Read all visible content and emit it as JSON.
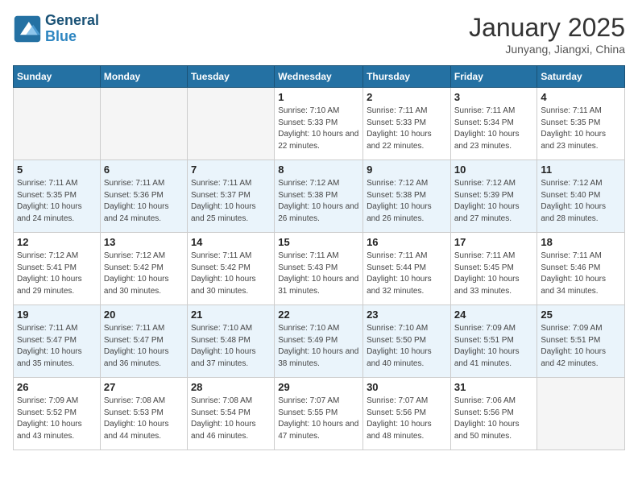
{
  "header": {
    "logo_line1": "General",
    "logo_line2": "Blue",
    "month_title": "January 2025",
    "location": "Junyang, Jiangxi, China"
  },
  "days_header": [
    "Sunday",
    "Monday",
    "Tuesday",
    "Wednesday",
    "Thursday",
    "Friday",
    "Saturday"
  ],
  "weeks": [
    [
      {
        "num": "",
        "sunrise": "",
        "sunset": "",
        "daylight": "",
        "empty": true
      },
      {
        "num": "",
        "sunrise": "",
        "sunset": "",
        "daylight": "",
        "empty": true
      },
      {
        "num": "",
        "sunrise": "",
        "sunset": "",
        "daylight": "",
        "empty": true
      },
      {
        "num": "1",
        "sunrise": "Sunrise: 7:10 AM",
        "sunset": "Sunset: 5:33 PM",
        "daylight": "Daylight: 10 hours and 22 minutes."
      },
      {
        "num": "2",
        "sunrise": "Sunrise: 7:11 AM",
        "sunset": "Sunset: 5:33 PM",
        "daylight": "Daylight: 10 hours and 22 minutes."
      },
      {
        "num": "3",
        "sunrise": "Sunrise: 7:11 AM",
        "sunset": "Sunset: 5:34 PM",
        "daylight": "Daylight: 10 hours and 23 minutes."
      },
      {
        "num": "4",
        "sunrise": "Sunrise: 7:11 AM",
        "sunset": "Sunset: 5:35 PM",
        "daylight": "Daylight: 10 hours and 23 minutes."
      }
    ],
    [
      {
        "num": "5",
        "sunrise": "Sunrise: 7:11 AM",
        "sunset": "Sunset: 5:35 PM",
        "daylight": "Daylight: 10 hours and 24 minutes."
      },
      {
        "num": "6",
        "sunrise": "Sunrise: 7:11 AM",
        "sunset": "Sunset: 5:36 PM",
        "daylight": "Daylight: 10 hours and 24 minutes."
      },
      {
        "num": "7",
        "sunrise": "Sunrise: 7:11 AM",
        "sunset": "Sunset: 5:37 PM",
        "daylight": "Daylight: 10 hours and 25 minutes."
      },
      {
        "num": "8",
        "sunrise": "Sunrise: 7:12 AM",
        "sunset": "Sunset: 5:38 PM",
        "daylight": "Daylight: 10 hours and 26 minutes."
      },
      {
        "num": "9",
        "sunrise": "Sunrise: 7:12 AM",
        "sunset": "Sunset: 5:38 PM",
        "daylight": "Daylight: 10 hours and 26 minutes."
      },
      {
        "num": "10",
        "sunrise": "Sunrise: 7:12 AM",
        "sunset": "Sunset: 5:39 PM",
        "daylight": "Daylight: 10 hours and 27 minutes."
      },
      {
        "num": "11",
        "sunrise": "Sunrise: 7:12 AM",
        "sunset": "Sunset: 5:40 PM",
        "daylight": "Daylight: 10 hours and 28 minutes."
      }
    ],
    [
      {
        "num": "12",
        "sunrise": "Sunrise: 7:12 AM",
        "sunset": "Sunset: 5:41 PM",
        "daylight": "Daylight: 10 hours and 29 minutes."
      },
      {
        "num": "13",
        "sunrise": "Sunrise: 7:12 AM",
        "sunset": "Sunset: 5:42 PM",
        "daylight": "Daylight: 10 hours and 30 minutes."
      },
      {
        "num": "14",
        "sunrise": "Sunrise: 7:11 AM",
        "sunset": "Sunset: 5:42 PM",
        "daylight": "Daylight: 10 hours and 30 minutes."
      },
      {
        "num": "15",
        "sunrise": "Sunrise: 7:11 AM",
        "sunset": "Sunset: 5:43 PM",
        "daylight": "Daylight: 10 hours and 31 minutes."
      },
      {
        "num": "16",
        "sunrise": "Sunrise: 7:11 AM",
        "sunset": "Sunset: 5:44 PM",
        "daylight": "Daylight: 10 hours and 32 minutes."
      },
      {
        "num": "17",
        "sunrise": "Sunrise: 7:11 AM",
        "sunset": "Sunset: 5:45 PM",
        "daylight": "Daylight: 10 hours and 33 minutes."
      },
      {
        "num": "18",
        "sunrise": "Sunrise: 7:11 AM",
        "sunset": "Sunset: 5:46 PM",
        "daylight": "Daylight: 10 hours and 34 minutes."
      }
    ],
    [
      {
        "num": "19",
        "sunrise": "Sunrise: 7:11 AM",
        "sunset": "Sunset: 5:47 PM",
        "daylight": "Daylight: 10 hours and 35 minutes."
      },
      {
        "num": "20",
        "sunrise": "Sunrise: 7:11 AM",
        "sunset": "Sunset: 5:47 PM",
        "daylight": "Daylight: 10 hours and 36 minutes."
      },
      {
        "num": "21",
        "sunrise": "Sunrise: 7:10 AM",
        "sunset": "Sunset: 5:48 PM",
        "daylight": "Daylight: 10 hours and 37 minutes."
      },
      {
        "num": "22",
        "sunrise": "Sunrise: 7:10 AM",
        "sunset": "Sunset: 5:49 PM",
        "daylight": "Daylight: 10 hours and 38 minutes."
      },
      {
        "num": "23",
        "sunrise": "Sunrise: 7:10 AM",
        "sunset": "Sunset: 5:50 PM",
        "daylight": "Daylight: 10 hours and 40 minutes."
      },
      {
        "num": "24",
        "sunrise": "Sunrise: 7:09 AM",
        "sunset": "Sunset: 5:51 PM",
        "daylight": "Daylight: 10 hours and 41 minutes."
      },
      {
        "num": "25",
        "sunrise": "Sunrise: 7:09 AM",
        "sunset": "Sunset: 5:51 PM",
        "daylight": "Daylight: 10 hours and 42 minutes."
      }
    ],
    [
      {
        "num": "26",
        "sunrise": "Sunrise: 7:09 AM",
        "sunset": "Sunset: 5:52 PM",
        "daylight": "Daylight: 10 hours and 43 minutes."
      },
      {
        "num": "27",
        "sunrise": "Sunrise: 7:08 AM",
        "sunset": "Sunset: 5:53 PM",
        "daylight": "Daylight: 10 hours and 44 minutes."
      },
      {
        "num": "28",
        "sunrise": "Sunrise: 7:08 AM",
        "sunset": "Sunset: 5:54 PM",
        "daylight": "Daylight: 10 hours and 46 minutes."
      },
      {
        "num": "29",
        "sunrise": "Sunrise: 7:07 AM",
        "sunset": "Sunset: 5:55 PM",
        "daylight": "Daylight: 10 hours and 47 minutes."
      },
      {
        "num": "30",
        "sunrise": "Sunrise: 7:07 AM",
        "sunset": "Sunset: 5:56 PM",
        "daylight": "Daylight: 10 hours and 48 minutes."
      },
      {
        "num": "31",
        "sunrise": "Sunrise: 7:06 AM",
        "sunset": "Sunset: 5:56 PM",
        "daylight": "Daylight: 10 hours and 50 minutes."
      },
      {
        "num": "",
        "sunrise": "",
        "sunset": "",
        "daylight": "",
        "empty": true
      }
    ]
  ]
}
